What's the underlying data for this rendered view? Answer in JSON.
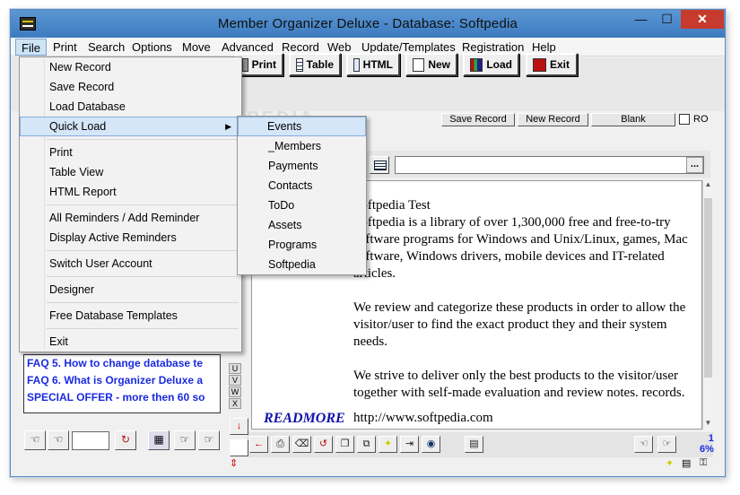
{
  "window": {
    "title": "Member Organizer Deluxe - Database: Softpedia",
    "min_symbol": "—",
    "max_symbol": "☐",
    "close_symbol": "✕"
  },
  "menubar": {
    "items": [
      "File",
      "Print",
      "Search",
      "Options",
      "Move",
      "Advanced",
      "Record",
      "Web",
      "Update/Templates",
      "Registration",
      "Help"
    ]
  },
  "toolbar": {
    "print_label": "Print",
    "table_label": "Table",
    "html_label": "HTML",
    "new_label": "New",
    "load_label": "Load",
    "exit_label": "Exit"
  },
  "record_bar": {
    "save_record": "Save Record",
    "new_record": "New Record",
    "blank": "Blank",
    "ro_label": "RO"
  },
  "file_menu": {
    "new_record": "New Record",
    "save_record": "Save Record",
    "load_database": "Load Database",
    "quick_load": "Quick Load",
    "print": "Print",
    "table_view": "Table View",
    "html_report": "HTML Report",
    "all_reminders": "All Reminders / Add Reminder",
    "display_reminders": "Display Active Reminders",
    "switch_user": "Switch User Account",
    "designer": "Designer",
    "free_templates": "Free Database Templates",
    "exit": "Exit"
  },
  "quick_load_menu": {
    "items": [
      "Events",
      "_Members",
      "Payments",
      "Contacts",
      "ToDo",
      "Assets",
      "Programs",
      "Softpedia"
    ]
  },
  "document": {
    "paragraphs": [
      "Softpedia Test\nSoftpedia is a library of over 1,300,000 free and free-to-try software programs for Windows and Unix/Linux, games, Mac software, Windows drivers, mobile devices and IT-related articles.",
      "We review and categorize these products in order to allow the visitor/user to find the exact product they and their system needs.",
      "We strive to deliver only the best products to the visitor/user together with self-made evaluation and review notes. records."
    ],
    "p0_line1": "Softpedia Test",
    "p0_body": "Softpedia is a library of over 1,300,000 free and free-to-try software programs for Windows and Unix/Linux, games, Mac software, Windows drivers, mobile devices and IT-related articles.",
    "p1": "We review and categorize these products in order to allow the visitor/user to find the exact product they and their system needs.",
    "p2": "We strive to deliver only the best products to the visitor/user together with self-made evaluation and review notes. records.",
    "readmore": "READMORE",
    "url": "http://www.softpedia.com"
  },
  "field_ellipsis": "...",
  "left_list": {
    "rows": [
      "FAQ 5. How to change database te",
      "FAQ 6. What is Organizer Deluxe a",
      "SPECIAL OFFER - more then 60 so"
    ]
  },
  "alpha_index": [
    "U",
    "V",
    "W",
    "X"
  ],
  "page_indicator": {
    "page": "1",
    "percent": "6%"
  },
  "colors": {
    "title_bar": "#4a88c8",
    "close_button": "#c73b2e",
    "link_blue": "#1a2ae0",
    "menu_highlight": "#d5e6f8"
  },
  "watermark": "SOFTPEDIA"
}
